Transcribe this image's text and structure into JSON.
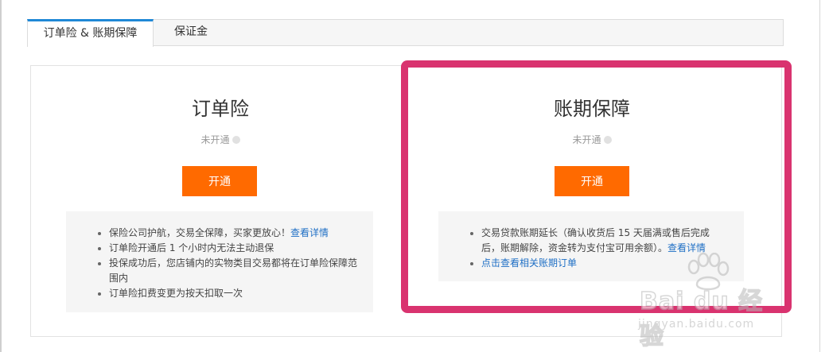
{
  "tabs": [
    {
      "label": "订单险 & 账期保障",
      "active": true
    },
    {
      "label": "保证金",
      "active": false
    }
  ],
  "cards": {
    "order_insurance": {
      "title": "订单险",
      "status": "未开通",
      "button_label": "开通",
      "items": [
        {
          "text": "保险公司护航，交易全保障，买家更放心！",
          "link": "查看详情"
        },
        {
          "text": "订单险开通后 1 个小时内无法主动退保"
        },
        {
          "text": "投保成功后，您店铺内的实物类目交易都将在订单险保障范围内"
        },
        {
          "text": "订单险扣费变更为按天扣取一次"
        }
      ]
    },
    "credit_protection": {
      "title": "账期保障",
      "status": "未开通",
      "button_label": "开通",
      "items": [
        {
          "text": "交易贷款账期延长（确认收货后 15 天届满或售后完成后，账期解除，资金转为支付宝可用余额）。",
          "link": "查看详情"
        },
        {
          "link": "点击查看相关账期订单"
        }
      ]
    }
  },
  "watermark": {
    "brand": "Bai du 经验",
    "url": "jingyan.baidu.com"
  },
  "colors": {
    "accent_button": "#ff6a00",
    "tab_active_border": "#1f88d6",
    "highlight": "#d9336f",
    "link": "#1f6fc5"
  },
  "icons": {
    "status_dot": "status-dot-icon",
    "watermark_logo": "baidu-paw-icon"
  }
}
